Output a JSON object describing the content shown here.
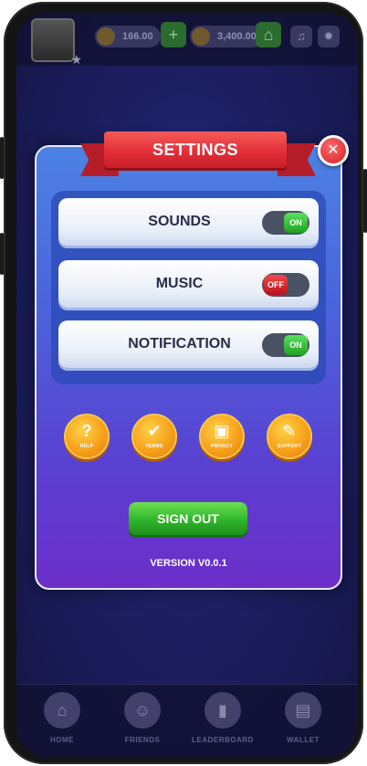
{
  "top_bar": {
    "coins": "166.00",
    "gems": "3,400.00",
    "plus_label": "+"
  },
  "dialog": {
    "title": "SETTINGS",
    "close_label": "✕",
    "settings": [
      {
        "label": "SOUNDS",
        "state": "ON"
      },
      {
        "label": "MUSIC",
        "state": "OFF"
      },
      {
        "label": "NOTIFICATION",
        "state": "ON"
      }
    ],
    "actions": [
      {
        "label": "HELP",
        "icon": "?"
      },
      {
        "label": "TERMS",
        "icon": "✔"
      },
      {
        "label": "PRIVACY",
        "icon": "▣"
      },
      {
        "label": "SUPPORT",
        "icon": "✎"
      }
    ],
    "signout_label": "SIGN OUT",
    "version": "VERSION V0.0.1"
  },
  "bottom_nav": [
    {
      "label": "HOME",
      "icon": "⌂"
    },
    {
      "label": "FRIENDS",
      "icon": "☺"
    },
    {
      "label": "LEADERBOARD",
      "icon": "▮"
    },
    {
      "label": "WALLET",
      "icon": "▤"
    }
  ],
  "colors": {
    "ribbon": "#e33038",
    "toggle_on": "#2fb52a",
    "toggle_off": "#d61d25",
    "action_buttons": "#f7a21b",
    "signout": "#2fb52a"
  }
}
